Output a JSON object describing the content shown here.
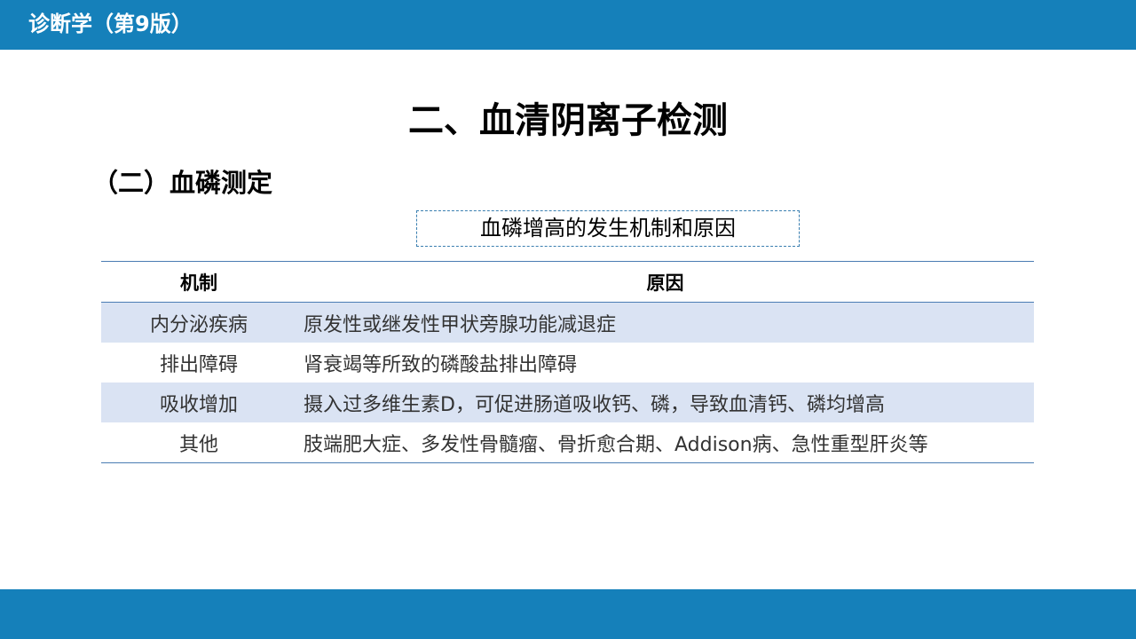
{
  "header": {
    "course_title": "诊断学（第9版）"
  },
  "slide": {
    "title": "二、血清阴离子检测",
    "section": "（二）血磷测定",
    "caption": "血磷增高的发生机制和原因"
  },
  "table": {
    "columns": [
      "机制",
      "原因"
    ],
    "rows": [
      {
        "mechanism": "内分泌疾病",
        "reason": "原发性或继发性甲状旁腺功能减退症"
      },
      {
        "mechanism": "排出障碍",
        "reason": "肾衰竭等所致的磷酸盐排出障碍"
      },
      {
        "mechanism": "吸收增加",
        "reason": "摄入过多维生素D，可促进肠道吸收钙、磷，导致血清钙、磷均增高"
      },
      {
        "mechanism": "其他",
        "reason": "肢端肥大症、多发性骨髓瘤、骨折愈合期、Addison病、急性重型肝炎等"
      }
    ]
  },
  "colors": {
    "bar": "#1580ba",
    "row_shade": "#dae3f3",
    "rule": "#4a7cb3"
  }
}
